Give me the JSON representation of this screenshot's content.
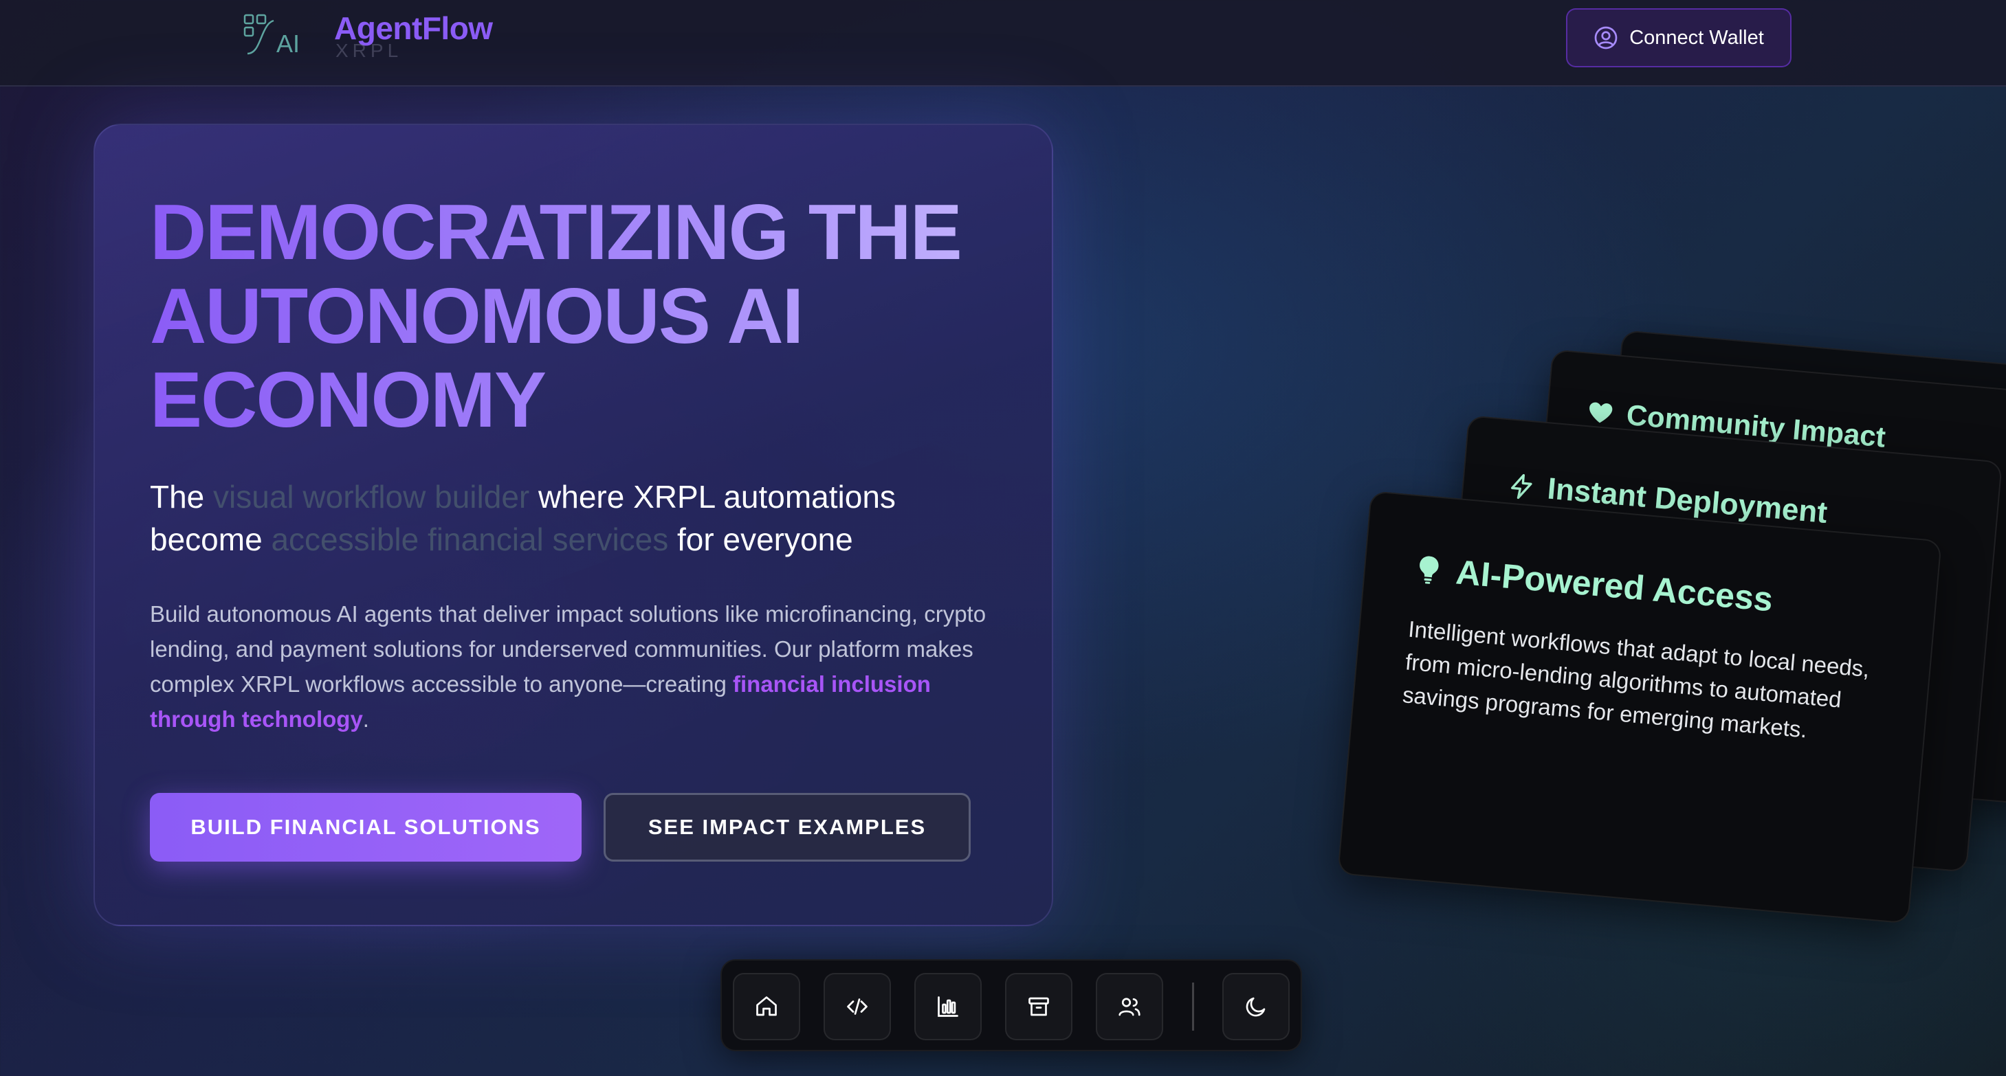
{
  "header": {
    "brand_name": "AgentFlow",
    "brand_sub": "XRPL",
    "connect_label": "Connect Wallet"
  },
  "hero": {
    "title": "DEMOCRATIZING THE AUTONOMOUS AI ECONOMY",
    "subtitle_parts": {
      "p1": "The ",
      "p2": "visual workflow builder",
      "p3": " where XRPL automations become ",
      "p4": "accessible financial services",
      "p5": " for everyone"
    },
    "description": "Build autonomous AI agents that deliver impact solutions like microfinancing, crypto lending, and payment solutions for underserved communities. Our platform makes complex XRPL workflows accessible to anyone—creating ",
    "description_accent": "financial inclusion through technology",
    "description_end": ".",
    "primary_button": "BUILD FINANCIAL SOLUTIONS",
    "secondary_button": "SEE IMPACT EXAMPLES"
  },
  "feature_cards": [
    {
      "title": "AI-Powered Access",
      "icon": "lightbulb-icon",
      "description": "Intelligent workflows that adapt to local needs, from micro-lending algorithms to automated savings programs for emerging markets."
    },
    {
      "title": "Instant Deployment",
      "icon": "lightning-icon"
    },
    {
      "title": "Community Impact",
      "icon": "heart-icon"
    }
  ],
  "dock": {
    "items": [
      "home-icon",
      "code-icon",
      "chart-icon",
      "archive-icon",
      "users-icon",
      "moon-icon"
    ]
  },
  "colors": {
    "accent": "#8b5cf6",
    "card_title": "#a7f3d0",
    "card_bg": "#0c0d10"
  }
}
